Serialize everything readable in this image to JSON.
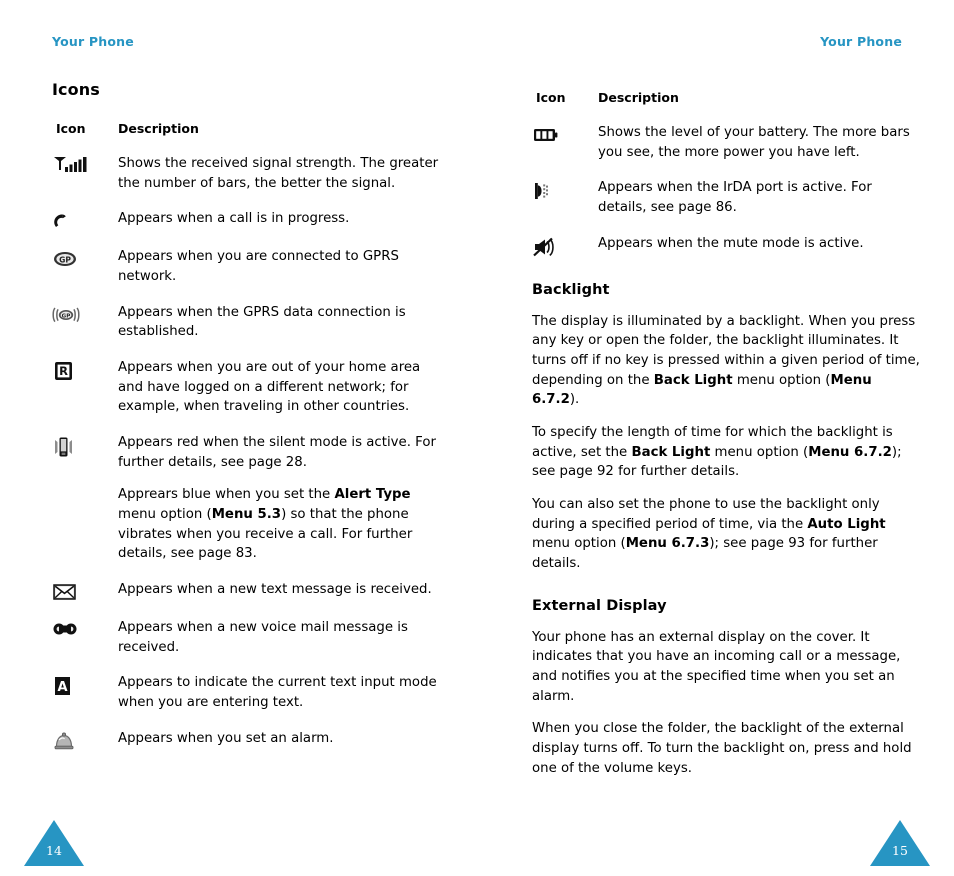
{
  "running_head": {
    "left": "Your Phone",
    "right": "Your Phone",
    "color": "#2795c3"
  },
  "left_page": {
    "section_title": "Icons",
    "table": {
      "headers": {
        "icon": "Icon",
        "description": "Description"
      },
      "rows": [
        {
          "icon": "signal-strength-icon",
          "paragraphs": [
            "Shows the received signal strength. The greater the number of bars, the better the signal."
          ]
        },
        {
          "icon": "call-in-progress-icon",
          "paragraphs": [
            "Appears when a call is in progress."
          ]
        },
        {
          "icon": "gprs-network-icon",
          "paragraphs": [
            "Appears when you are connected to GPRS network."
          ]
        },
        {
          "icon": "gprs-data-connection-icon",
          "paragraphs": [
            "Appears when the GPRS data connection is established."
          ]
        },
        {
          "icon": "roaming-icon",
          "paragraphs": [
            "Appears when you are out of your home area and have logged on a different network; for example, when traveling in other countries."
          ]
        },
        {
          "icon": "silent-vibrate-icon",
          "paragraphs": [
            "Appears red when the silent mode is active. For further details, see page 28.",
            "Apprears blue when you set the Alert Type menu option (Menu 5.3) so that the phone vibrates when you receive a call. For further details, see page 83."
          ],
          "paragraph_2_runs": [
            {
              "t": "Apprears blue when you set the ",
              "b": false
            },
            {
              "t": "Alert Type",
              "b": true
            },
            {
              "t": " menu option (",
              "b": false
            },
            {
              "t": "Menu 5.3",
              "b": true
            },
            {
              "t": ") so that the phone vibrates when you receive a call. For further details, see page 83.",
              "b": false
            }
          ]
        },
        {
          "icon": "new-text-message-icon",
          "paragraphs": [
            "Appears when a new text message is received."
          ]
        },
        {
          "icon": "new-voice-mail-icon",
          "paragraphs": [
            "Appears when a new voice mail message is received."
          ]
        },
        {
          "icon": "text-input-mode-icon",
          "paragraphs": [
            "Appears to indicate the current text input mode when you are entering text."
          ]
        },
        {
          "icon": "alarm-icon",
          "paragraphs": [
            "Appears when you set an alarm."
          ]
        }
      ]
    },
    "folio": "14"
  },
  "right_page": {
    "table": {
      "headers": {
        "icon": "Icon",
        "description": "Description"
      },
      "rows": [
        {
          "icon": "battery-level-icon",
          "paragraphs": [
            "Shows the level of your battery. The more bars you see, the more power you have left."
          ]
        },
        {
          "icon": "irda-port-icon",
          "paragraphs": [
            "Appears when the IrDA port is active. For details, see page 86."
          ]
        },
        {
          "icon": "mute-mode-icon",
          "paragraphs": [
            "Appears when the mute mode is active."
          ]
        }
      ]
    },
    "backlight": {
      "heading": "Backlight",
      "p1_runs": [
        {
          "t": "The display is illuminated by a backlight. When you press any key or open the folder, the backlight illuminates. It turns off if no key is pressed within a given period of time, depending on the ",
          "b": false
        },
        {
          "t": "Back Light",
          "b": true
        },
        {
          "t": " menu option (",
          "b": false
        },
        {
          "t": "Menu 6.7.2",
          "b": true
        },
        {
          "t": ").",
          "b": false
        }
      ],
      "p2_runs": [
        {
          "t": "To specify the length of time for which the backlight is active, set the ",
          "b": false
        },
        {
          "t": "Back Light",
          "b": true
        },
        {
          "t": " menu option (",
          "b": false
        },
        {
          "t": "Menu 6.7.2",
          "b": true
        },
        {
          "t": "); see page 92 for further details.",
          "b": false
        }
      ],
      "p3_runs": [
        {
          "t": "You can also set the phone to use the backlight only during a specified period of time, via the ",
          "b": false
        },
        {
          "t": "Auto Light",
          "b": true
        },
        {
          "t": " menu option (",
          "b": false
        },
        {
          "t": "Menu 6.7.3",
          "b": true
        },
        {
          "t": "); see page 93 for further details.",
          "b": false
        }
      ]
    },
    "external_display": {
      "heading": "External Display",
      "p1": "Your phone has an external display on the cover. It indicates that you have an incoming call or a message, and notifies you at the specified time when you set an alarm.",
      "p2": "When you close the folder, the backlight of the external display turns off. To turn the backlight on, press and hold one of the volume keys."
    },
    "folio": "15"
  }
}
